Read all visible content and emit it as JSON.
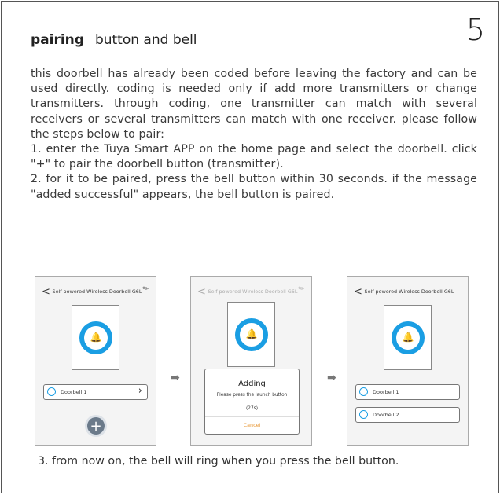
{
  "page_number": "5",
  "title": {
    "bold": "pairing",
    "rest": "button and bell"
  },
  "paragraphs": [
    "this doorbell has already been coded before leaving the factory and can be used directly. coding is needed only if add more transmitters or change transmitters. through coding, one transmitter can match with several receivers or several transmitters can match with one receiver. please follow the steps below to pair:",
    "1. enter the Tuya Smart APP on the home page and select the doorbell. click \"+\" to pair the doorbell button (transmitter).",
    "2. for it to be paired, press the bell button within 30 seconds. if the message \"added successful\" appears, the bell button is paired."
  ],
  "screens": {
    "header_title": "Self-powered Wireless Doorbell G6L",
    "back_icon": "<",
    "edit_icon": "✎",
    "screen1": {
      "device_label": "Doorbell 1",
      "add_button": "+"
    },
    "screen2": {
      "dialog_title": "Adding",
      "dialog_message": "Please press the launch button",
      "countdown": "(27s)",
      "cancel_label": "Cancel"
    },
    "screen3": {
      "device1_label": "Doorbell 1",
      "device2_label": "Doorbell 2"
    }
  },
  "arrow_glyph": "➡",
  "footer": "3. from now on, the bell will ring when you press the bell button.",
  "colors": {
    "accent_blue": "#1a9ee3",
    "cancel_orange": "#e89a3a",
    "border": "#555555"
  }
}
